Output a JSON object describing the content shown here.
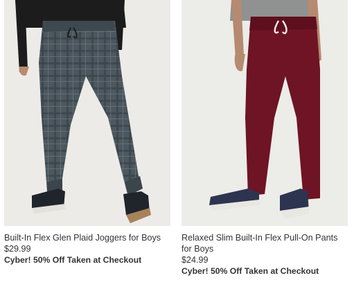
{
  "products": [
    {
      "title": "Built-In Flex Glen Plaid Joggers for Boys",
      "price": "$29.99",
      "promo": "Cyber! 50% Off Taken at Checkout",
      "colors": {
        "pants": "#4a555c",
        "plaid": "#2f3a42",
        "background": "#ecebe7",
        "shirt": "#1c1c1c"
      }
    },
    {
      "title": "Relaxed Slim Built-In Flex Pull-On Pants for Boys",
      "price": "$24.99",
      "promo": "Cyber! 50% Off Taken at Checkout",
      "colors": {
        "pants": "#6e1424",
        "plaid": "#5a0f1c",
        "background": "#ecece8",
        "shirt": "#8f9290"
      }
    }
  ]
}
